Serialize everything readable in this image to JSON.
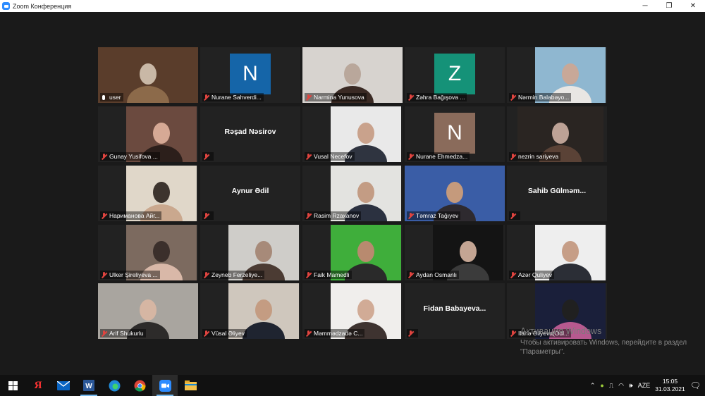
{
  "window": {
    "title": "Zoom Конференция",
    "buttons": [
      "─",
      "❐",
      "✕"
    ]
  },
  "participants": [
    {
      "name": "user",
      "type": "video",
      "active": true,
      "muted": false
    },
    {
      "name": "Nurane Sahverdi...",
      "type": "letter",
      "letter": "N",
      "color": "#1565a8",
      "muted": true
    },
    {
      "name": "Narmina Yunusova",
      "type": "video",
      "muted": true
    },
    {
      "name": "Zəhra Bağışova ...",
      "type": "letter",
      "letter": "Z",
      "color": "#159278",
      "muted": true
    },
    {
      "name": "Nərmin Balabəyo...",
      "type": "video",
      "muted": true
    },
    {
      "name": "Gunay Yusifova ...",
      "type": "video",
      "muted": true
    },
    {
      "name": "",
      "display_name": "Rəşad Nəsirov",
      "type": "name",
      "muted": true
    },
    {
      "name": "Vusal Necefov",
      "type": "video",
      "muted": true
    },
    {
      "name": "Nurane Ehmedza...",
      "type": "letter",
      "letter": "N",
      "color": "#8a6b5b",
      "muted": true
    },
    {
      "name": "nezrin sariyeva",
      "type": "video",
      "muted": true
    },
    {
      "name": "Нариманова Айг...",
      "type": "video",
      "muted": true
    },
    {
      "name": "",
      "display_name": "Aynur Ədil",
      "type": "name",
      "muted": true
    },
    {
      "name": "Rasim Rzaxanov",
      "type": "video",
      "muted": true
    },
    {
      "name": "Təmraz Tağıyev",
      "type": "video",
      "muted": true
    },
    {
      "name": "",
      "display_name": "Sahib  Gülməm...",
      "type": "name",
      "muted": true
    },
    {
      "name": "Ulker Şireliyeva ...",
      "type": "video",
      "muted": true
    },
    {
      "name": "Zeyneb Ferzeliye...",
      "type": "video",
      "muted": true
    },
    {
      "name": "Faik Mamedli",
      "type": "video",
      "muted": true
    },
    {
      "name": "Aydan Osmanlı",
      "type": "video",
      "muted": true
    },
    {
      "name": "Azər Quliyev",
      "type": "video",
      "muted": true
    },
    {
      "name": "Arif Shukurlu",
      "type": "video",
      "muted": true
    },
    {
      "name": "Vüsal Əliyev",
      "type": "video",
      "muted": true
    },
    {
      "name": "Məmmədzadə C...",
      "type": "video",
      "muted": true
    },
    {
      "name": "",
      "display_name": "Fidan  Babayeva...",
      "type": "name",
      "muted": true
    },
    {
      "name": "Ilahə Əliyeva(Odl...",
      "type": "video",
      "muted": true
    }
  ],
  "watermark": {
    "line1": "Активация Windows",
    "line2": "Чтобы активировать Windows, перейдите в раздел \"Параметры\"."
  },
  "taskbar": {
    "icons": [
      "windows-start-icon",
      "yandex-browser-icon",
      "mail-icon",
      "word-icon",
      "edge-icon",
      "chrome-icon",
      "zoom-icon",
      "file-explorer-icon"
    ],
    "lang": "AZE",
    "time": "15:05",
    "date": "31.03.2021"
  }
}
